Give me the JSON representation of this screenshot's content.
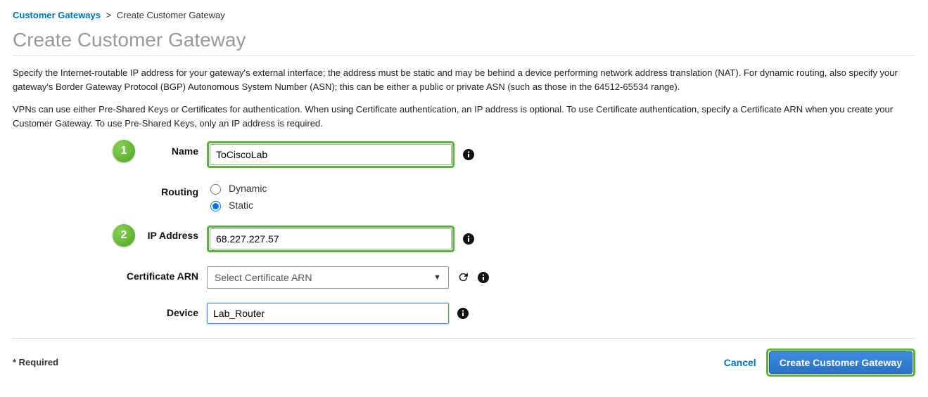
{
  "breadcrumb": {
    "parent": "Customer Gateways",
    "separator": ">",
    "current": "Create Customer Gateway"
  },
  "page_title": "Create Customer Gateway",
  "intro": {
    "p1": "Specify the Internet-routable IP address for your gateway's external interface; the address must be static and may be behind a device performing network address translation (NAT). For dynamic routing, also specify your gateway's Border Gateway Protocol (BGP) Autonomous System Number (ASN); this can be either a public or private ASN (such as those in the 64512-65534 range).",
    "p2": "VPNs can use either Pre-Shared Keys or Certificates for authentication. When using Certificate authentication, an IP address is optional. To use Certificate authentication, specify a Certificate ARN when you create your Customer Gateway. To use Pre-Shared Keys, only an IP address is required."
  },
  "callouts": {
    "one": "1",
    "two": "2"
  },
  "form": {
    "name": {
      "label": "Name",
      "value": "ToCiscoLab"
    },
    "routing": {
      "label": "Routing",
      "options": {
        "dynamic": "Dynamic",
        "static": "Static"
      },
      "selected": "static"
    },
    "ip": {
      "label": "IP Address",
      "value": "68.227.227.57"
    },
    "cert": {
      "label": "Certificate ARN",
      "placeholder": "Select Certificate ARN"
    },
    "device": {
      "label": "Device",
      "value": "Lab_Router"
    }
  },
  "footer": {
    "required": "* Required",
    "cancel": "Cancel",
    "submit": "Create Customer Gateway"
  }
}
